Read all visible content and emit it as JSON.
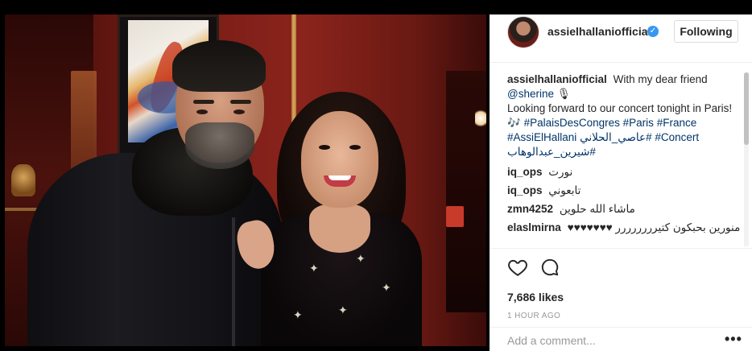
{
  "post": {
    "username": "assielhallaniofficial",
    "verified_mark": "✓",
    "follow_label": "Following",
    "caption": {
      "user": "assielhallaniofficial",
      "line1": "With my dear friend",
      "mention": "@sherine",
      "line2": "Looking forward to our concert tonight in Paris! 🎶",
      "tags": [
        "#PalaisDesCongres",
        "#Paris",
        "#France",
        "#AssiElHallani",
        "#عاصي_الحلاني",
        "#Concert",
        "#شيرين_عبدالوهاب"
      ]
    },
    "comments": [
      {
        "user": "iq_ops",
        "text": "نورت"
      },
      {
        "user": "iq_ops",
        "text": "تابعوني"
      },
      {
        "user": "zmn4252",
        "text": "ماشاء الله حلوين"
      },
      {
        "user": "elaslmirna",
        "text": "منورين بحبكون كتيرررررررر ♥♥♥♥♥♥♥"
      }
    ],
    "likes": "7,686 likes",
    "time": "1 HOUR AGO",
    "comment_placeholder": "Add a comment...",
    "more_label": "•••"
  },
  "icons": {
    "like": "heart-icon",
    "comment": "comment-icon",
    "verified": "verified-badge-icon",
    "more": "more-options-icon"
  },
  "colors": {
    "link": "#003569",
    "verified": "#3897f0",
    "muted": "#999999"
  }
}
